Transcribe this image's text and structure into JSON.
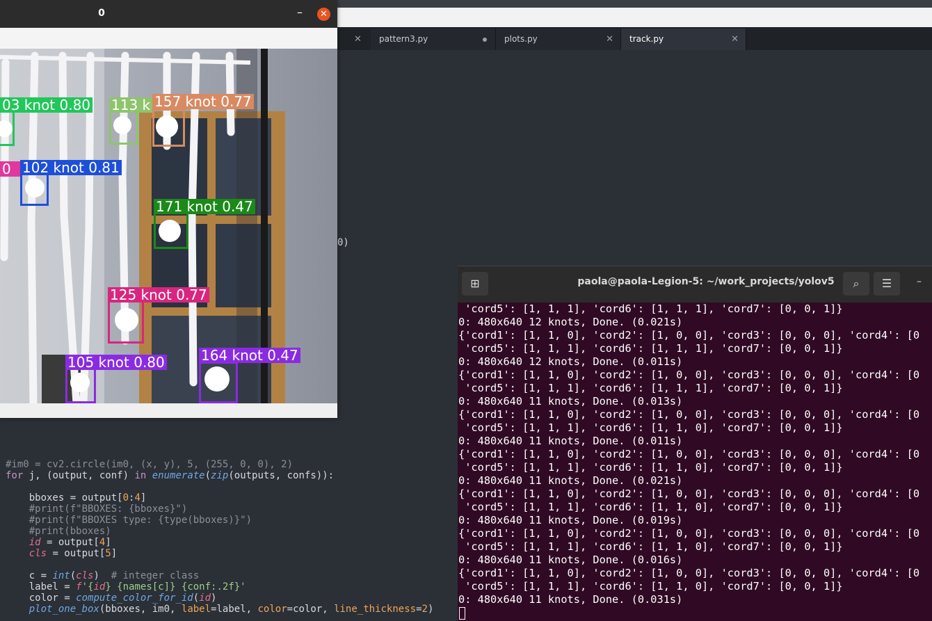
{
  "editor": {
    "tabs": [
      {
        "label": "pattern3.py",
        "modified": false
      },
      {
        "label": "plots.py",
        "modified": true
      },
      {
        "label": "track.py",
        "modified": false,
        "active": true
      }
    ],
    "partial_text": "0)",
    "code_lines": [
      [
        {
          "t": "#im0 = cv2.circle(im0, (x, y), 5, (255, 0, 0), 2)",
          "c": "cm"
        }
      ],
      [
        {
          "t": "for",
          "c": "kw"
        },
        {
          "t": " j, (output, conf) "
        },
        {
          "t": "in",
          "c": "kw"
        },
        {
          "t": " "
        },
        {
          "t": "enumerate",
          "c": "fn"
        },
        {
          "t": "("
        },
        {
          "t": "zip",
          "c": "fn"
        },
        {
          "t": "(outputs, confs)):"
        }
      ],
      [],
      [
        {
          "t": "    bboxes = output["
        },
        {
          "t": "0",
          "c": "num"
        },
        {
          "t": ":"
        },
        {
          "t": "4",
          "c": "num"
        },
        {
          "t": "]"
        }
      ],
      [
        {
          "t": "    #print(f\"BBOXES: {bboxes}\")",
          "c": "cm"
        }
      ],
      [
        {
          "t": "    #print(f\"BBOXES type: {type(bboxes)}\")",
          "c": "cm"
        }
      ],
      [
        {
          "t": "    #print(bboxes)",
          "c": "cm"
        }
      ],
      [
        {
          "t": "    "
        },
        {
          "t": "id",
          "c": "it"
        },
        {
          "t": " = output["
        },
        {
          "t": "4",
          "c": "num"
        },
        {
          "t": "]"
        }
      ],
      [
        {
          "t": "    "
        },
        {
          "t": "cls",
          "c": "it"
        },
        {
          "t": " = output["
        },
        {
          "t": "5",
          "c": "num"
        },
        {
          "t": "]"
        }
      ],
      [],
      [
        {
          "t": "    c = "
        },
        {
          "t": "int",
          "c": "fn"
        },
        {
          "t": "("
        },
        {
          "t": "cls",
          "c": "it"
        },
        {
          "t": ")  "
        },
        {
          "t": "# integer class",
          "c": "cm"
        }
      ],
      [
        {
          "t": "    label = "
        },
        {
          "t": "f",
          "c": "it"
        },
        {
          "t": "'{",
          "c": "str"
        },
        {
          "t": "id",
          "c": "it"
        },
        {
          "t": "} {names[c]} {conf:.2f}'",
          "c": "str"
        }
      ],
      [
        {
          "t": "    color = "
        },
        {
          "t": "compute_color_for_id",
          "c": "fn"
        },
        {
          "t": "("
        },
        {
          "t": "id",
          "c": "it"
        },
        {
          "t": ")"
        }
      ],
      [
        {
          "t": "    "
        },
        {
          "t": "plot_one_box",
          "c": "fn"
        },
        {
          "t": "(bboxes, im0, "
        },
        {
          "t": "label",
          "c": "par"
        },
        {
          "t": "=label, "
        },
        {
          "t": "color",
          "c": "par"
        },
        {
          "t": "=color, "
        },
        {
          "t": "line_thickness",
          "c": "par"
        },
        {
          "t": "="
        },
        {
          "t": "2",
          "c": "num"
        },
        {
          "t": ")"
        }
      ]
    ]
  },
  "image_window": {
    "title": "0",
    "minimize_icon": "minimize-icon",
    "close_icon": "close-icon",
    "detections": [
      {
        "label": "03 knot 0.80",
        "color": "#22c65a"
      },
      {
        "label": "113 k",
        "color": "#8fc46c"
      },
      {
        "label": "157 knot 0.77",
        "color": "#d98a62"
      },
      {
        "label": "0",
        "color": "#e0389c"
      },
      {
        "label": "102 knot 0.81",
        "color": "#1d4fd8"
      },
      {
        "label": "171 knot 0.47",
        "color": "#1a8a18"
      },
      {
        "label": "125 knot 0.77",
        "color": "#d8267f"
      },
      {
        "label": "105 knot 0.80",
        "color": "#8a2be2"
      },
      {
        "label": "164 knot 0.47",
        "color": "#8a2be2"
      }
    ]
  },
  "terminal": {
    "title": "paola@paola-Legion-5: ~/work_projects/yolov5",
    "new_tab_icon": "new-tab-icon",
    "search_icon": "search-icon",
    "menu_icon": "menu-icon",
    "minimize_icon": "minimize-icon",
    "lines": [
      " 'cord5': [1, 1, 1], 'cord6': [1, 1, 1], 'cord7': [0, 0, 1]}",
      "0: 480x640 12 knots, Done. (0.021s)",
      "{'cord1': [1, 1, 0], 'cord2': [1, 0, 0], 'cord3': [0, 0, 0], 'cord4': [0",
      " 'cord5': [1, 1, 1], 'cord6': [1, 1, 1], 'cord7': [0, 0, 1]}",
      "0: 480x640 12 knots, Done. (0.011s)",
      "{'cord1': [1, 1, 0], 'cord2': [1, 0, 0], 'cord3': [0, 0, 0], 'cord4': [0",
      " 'cord5': [1, 1, 1], 'cord6': [1, 1, 1], 'cord7': [0, 0, 1]}",
      "0: 480x640 11 knots, Done. (0.013s)",
      "{'cord1': [1, 1, 0], 'cord2': [1, 0, 0], 'cord3': [0, 0, 0], 'cord4': [0",
      " 'cord5': [1, 1, 1], 'cord6': [1, 1, 0], 'cord7': [0, 0, 1]}",
      "0: 480x640 11 knots, Done. (0.011s)",
      "{'cord1': [1, 1, 0], 'cord2': [1, 0, 0], 'cord3': [0, 0, 0], 'cord4': [0",
      " 'cord5': [1, 1, 1], 'cord6': [1, 1, 0], 'cord7': [0, 0, 1]}",
      "0: 480x640 11 knots, Done. (0.021s)",
      "{'cord1': [1, 1, 0], 'cord2': [1, 0, 0], 'cord3': [0, 0, 0], 'cord4': [0",
      " 'cord5': [1, 1, 1], 'cord6': [1, 1, 0], 'cord7': [0, 0, 1]}",
      "0: 480x640 11 knots, Done. (0.019s)",
      "{'cord1': [1, 1, 0], 'cord2': [1, 0, 0], 'cord3': [0, 0, 0], 'cord4': [0",
      " 'cord5': [1, 1, 1], 'cord6': [1, 1, 0], 'cord7': [0, 0, 1]}",
      "0: 480x640 11 knots, Done. (0.016s)",
      "{'cord1': [1, 1, 0], 'cord2': [1, 0, 0], 'cord3': [0, 0, 0], 'cord4': [0",
      " 'cord5': [1, 1, 1], 'cord6': [1, 1, 0], 'cord7': [0, 0, 1]}",
      "0: 480x640 11 knots, Done. (0.031s)"
    ]
  }
}
